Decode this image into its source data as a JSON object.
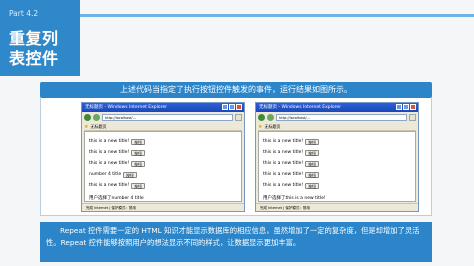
{
  "header": {
    "part": "Part 4.2",
    "title_line1": "重复列",
    "title_line2": "表控件"
  },
  "banner": {
    "text": "上述代码当指定了执行按钮控件触发的事件，运行结果如图所示。"
  },
  "windows": [
    {
      "title": "无标题页 - Windows Internet Explorer",
      "address": "http://localhost/...",
      "fav_label": "无标题页",
      "rows": [
        {
          "text": "this is a new title!",
          "button": "按钮"
        },
        {
          "text": "this is a new title!",
          "button": "按钮"
        },
        {
          "text": "this is a new title!",
          "button": "按钮"
        },
        {
          "text": "number 4 title",
          "button": "按钮"
        },
        {
          "text": "this is a new title!",
          "button": "按钮"
        }
      ],
      "message": "用户选择了number 4 title",
      "status": "完成    Internet | 保护模式：禁用"
    },
    {
      "title": "无标题页 - Windows Internet Explorer",
      "address": "http://localhost/...",
      "fav_label": "无标题页",
      "rows": [
        {
          "text": "this is a new title!",
          "button": "按钮"
        },
        {
          "text": "this is a new title!",
          "button": "按钮"
        },
        {
          "text": "this is a new title!",
          "button": "按钮"
        },
        {
          "text": "this is a new title!",
          "button": "按钮"
        },
        {
          "text": "this is a new title!",
          "button": "按钮"
        }
      ],
      "message": "用户选择了this is a new title!",
      "status": "完成    Internet | 保护模式：禁用"
    }
  ],
  "description": {
    "text": "Repeat 控件需要一定的 HTML 知识才能显示数据库的相应信息，虽然增加了一定的复杂度，但是却增加了灵活性。Repeat 控件能够按照用户的想法显示不同的样式，让数据显示更加丰富。"
  },
  "colors": {
    "accent": "#2b85c8",
    "title_block": "#2f88c9",
    "background": "#f4f6f8"
  }
}
